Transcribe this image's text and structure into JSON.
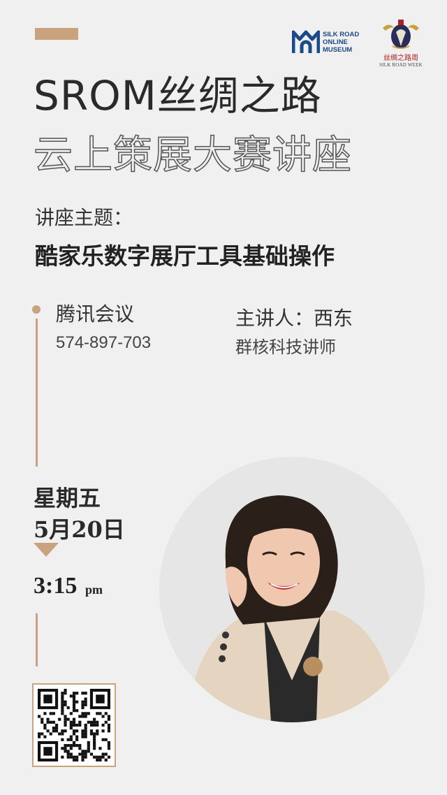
{
  "logos": {
    "srom_lines": [
      "SILK ROAD",
      "ONLINE",
      "MUSEUM"
    ],
    "silk_road_week_cn": "丝绸之路周",
    "silk_road_week_en": "SILK ROAD WEEK"
  },
  "title": {
    "line1": "SROM丝绸之路",
    "line2": "云上策展大赛讲座"
  },
  "topic": {
    "label": "讲座主题：",
    "value": "酷家乐数字展厅工具基础操作"
  },
  "meeting": {
    "platform": "腾讯会议",
    "id": "574-897-703"
  },
  "speaker": {
    "name_line": "主讲人：西东",
    "title": "群核科技讲师"
  },
  "schedule": {
    "weekday": "星期五",
    "date": "5月20日",
    "time": "3:15",
    "ampm": "pm"
  },
  "colors": {
    "accent": "#c9a27e",
    "background": "#f0f0f0",
    "text": "#2a2a2a",
    "srom_blue": "#1a4a8a"
  },
  "icons": {
    "srom_logo": "srom-logo-icon",
    "silk_road_week_logo": "silk-road-week-emblem-icon",
    "qr": "qr-code-icon"
  }
}
